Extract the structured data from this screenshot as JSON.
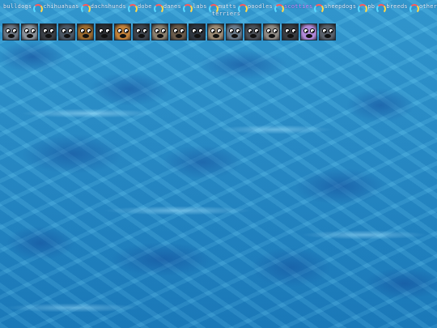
{
  "nav": {
    "row1": [
      {
        "label": "bulldogs",
        "active": false
      },
      {
        "label": "chihuahuas",
        "active": false
      },
      {
        "label": "dachshunds",
        "active": false
      },
      {
        "label": "dobe",
        "active": false
      },
      {
        "label": "danes",
        "active": false
      },
      {
        "label": "labs",
        "active": false
      },
      {
        "label": "mutts",
        "active": false
      },
      {
        "label": "poodles",
        "active": false
      },
      {
        "label": "scotties",
        "active": true
      },
      {
        "label": "sheepdogs",
        "active": false
      },
      {
        "label": "pb",
        "active": false
      },
      {
        "label": "breeds",
        "active": false
      },
      {
        "label": "other",
        "active": false
      }
    ],
    "row2": [
      {
        "label": "terriers",
        "active": false
      }
    ]
  },
  "thumbnails": [
    {
      "name": "dog-1",
      "color": "#6b7480"
    },
    {
      "name": "dog-2",
      "color": "#8a9199"
    },
    {
      "name": "dog-3",
      "color": "#3b3f45"
    },
    {
      "name": "dog-4",
      "color": "#4b5663"
    },
    {
      "name": "dog-5",
      "color": "#9a6a2f"
    },
    {
      "name": "dog-6",
      "color": "#2b2e33"
    },
    {
      "name": "dog-7",
      "color": "#c2823a"
    },
    {
      "name": "dog-8",
      "color": "#3e444c"
    },
    {
      "name": "dog-9",
      "color": "#8a7f6e"
    },
    {
      "name": "dog-10",
      "color": "#6a5a4a"
    },
    {
      "name": "dog-11",
      "color": "#2f3640"
    },
    {
      "name": "dog-12",
      "color": "#9b8a74"
    },
    {
      "name": "dog-13",
      "color": "#6a7a8a"
    },
    {
      "name": "dog-14",
      "color": "#4a4f56"
    },
    {
      "name": "dog-15",
      "color": "#8f8a84"
    },
    {
      "name": "dog-16",
      "color": "#3a3d42"
    },
    {
      "name": "dog-17",
      "color": "#b088d8"
    },
    {
      "name": "dog-18",
      "color": "#5a606a"
    }
  ]
}
